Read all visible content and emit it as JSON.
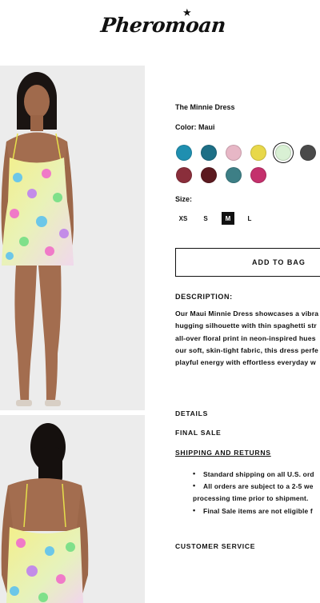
{
  "brand": {
    "logo_text": "Pheromoan"
  },
  "product": {
    "title": "The Minnie Dress",
    "color_line": "Color: Maui",
    "swatches": [
      {
        "name": "teal-print",
        "color": "#1f8fb0"
      },
      {
        "name": "blue-snake",
        "color": "#1d6f86"
      },
      {
        "name": "pink-floral",
        "color": "#e7b7c6"
      },
      {
        "name": "yellow-dot",
        "color": "#e8d84a"
      },
      {
        "name": "maui",
        "color": "#d9f0d4"
      },
      {
        "name": "charcoal-dot",
        "color": "#4a4a4a"
      },
      {
        "name": "burgundy-dot",
        "color": "#8a2e3b"
      },
      {
        "name": "maroon",
        "color": "#5c1a20"
      },
      {
        "name": "rainbow",
        "color": "#3d7f86"
      },
      {
        "name": "magenta",
        "color": "#c4306c"
      }
    ],
    "size_label": "Size:",
    "sizes": [
      "XS",
      "S",
      "M",
      "L"
    ],
    "selected_size": "M",
    "add_to_bag": "ADD TO BAG"
  },
  "description": {
    "heading": "DESCRIPTION:",
    "lines": [
      "Our Maui Minnie Dress showcases a vibra",
      "hugging silhouette with thin spaghetti str",
      "all-over floral print in neon-inspired hues",
      "our soft, skin-tight fabric, this dress perfe",
      "playful energy with effortless everyday w"
    ]
  },
  "accordion": {
    "details": "DETAILS",
    "final_sale": "FINAL SALE",
    "shipping": "SHIPPING AND RETURNS",
    "customer_service": "CUSTOMER SERVICE"
  },
  "shipping_bullets": {
    "b1": "Standard shipping on all U.S. ord",
    "b2a": "All orders are subject to a 2-5 we",
    "b2b": "processing time prior to shipment.",
    "b3": "Final Sale items are not eligible f"
  }
}
